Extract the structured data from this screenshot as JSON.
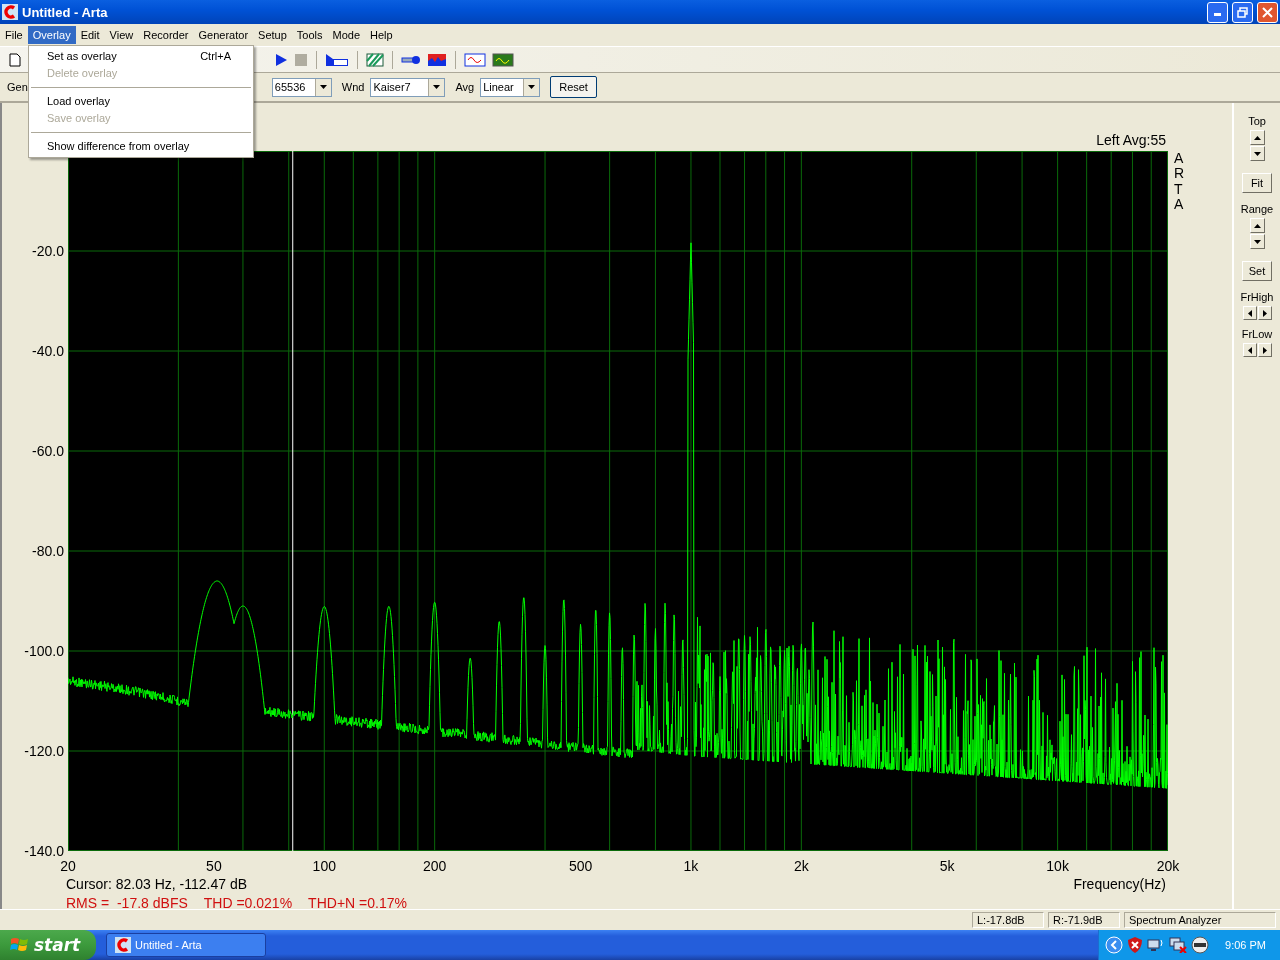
{
  "window": {
    "title": "Untitled - Arta"
  },
  "menu_bar": [
    {
      "label": "File",
      "selected": false
    },
    {
      "label": "Overlay",
      "selected": true
    },
    {
      "label": "Edit",
      "selected": false
    },
    {
      "label": "View",
      "selected": false
    },
    {
      "label": "Recorder",
      "selected": false
    },
    {
      "label": "Generator",
      "selected": false
    },
    {
      "label": "Setup",
      "selected": false
    },
    {
      "label": "Tools",
      "selected": false
    },
    {
      "label": "Mode",
      "selected": false
    },
    {
      "label": "Help",
      "selected": false
    }
  ],
  "overlay_menu": [
    {
      "kind": "item",
      "label": "Set as overlay",
      "shortcut": "Ctrl+A",
      "disabled": false
    },
    {
      "kind": "item",
      "label": "Delete overlay",
      "disabled": true
    },
    {
      "kind": "separator"
    },
    {
      "kind": "item",
      "label": "Load overlay",
      "disabled": false
    },
    {
      "kind": "item",
      "label": "Save overlay",
      "disabled": true
    },
    {
      "kind": "separator"
    },
    {
      "kind": "item",
      "label": "Show difference from overlay",
      "disabled": false
    }
  ],
  "controls": {
    "gen_label": "Gen",
    "fft_size": "65536",
    "wnd_label": "Wnd",
    "window_function": "Kaiser7",
    "avg_label": "Avg",
    "averaging": "Linear",
    "reset_button": "Reset"
  },
  "plot": {
    "channel_info": "Left  Avg:55",
    "side_label": "ARTA",
    "y_tick_labels": [
      "-20.0",
      "-40.0",
      "-60.0",
      "-80.0",
      "-100.0",
      "-120.0",
      "-140.0"
    ],
    "x_tick_labels": [
      "20",
      "50",
      "100",
      "200",
      "500",
      "1k",
      "2k",
      "5k",
      "10k",
      "20k"
    ],
    "x_axis_title": "Frequency(Hz)",
    "cursor": "Cursor: 82.03 Hz, -112.47 dB",
    "measurements": [
      "RMS =  -17.8 dBFS",
      "THD =0.021%",
      "THD+N =0.17%"
    ]
  },
  "side_panel": [
    {
      "kind": "spin",
      "label": "Top"
    },
    {
      "kind": "button",
      "label": "Fit"
    },
    {
      "kind": "spin",
      "label": "Range"
    },
    {
      "kind": "button",
      "label": "Set"
    },
    {
      "kind": "hspin",
      "label": "FrHigh"
    },
    {
      "kind": "hspin",
      "label": "FrLow"
    }
  ],
  "status_bar": [
    "L:-17.8dB",
    "R:-71.9dB",
    "Spectrum Analyzer"
  ],
  "taskbar": {
    "start": "start",
    "tasks": [
      {
        "label": "Untitled - Arta",
        "selected": false
      }
    ],
    "clock": "9:06 PM"
  }
}
